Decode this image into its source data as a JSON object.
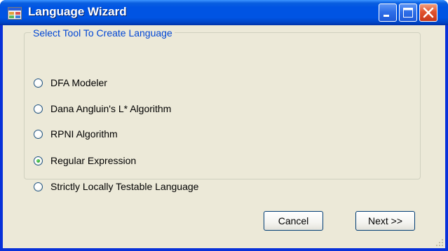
{
  "window": {
    "title": "Language Wizard",
    "icons": {
      "app": "app-icon",
      "minimize": "minimize-icon",
      "maximize": "maximize-icon",
      "close": "close-icon"
    }
  },
  "group": {
    "legend": "Select Tool To Create Language",
    "options": [
      {
        "label": "DFA Modeler",
        "selected": false
      },
      {
        "label": "Dana Angluin's L* Algorithm",
        "selected": false
      },
      {
        "label": "RPNI Algorithm",
        "selected": false
      },
      {
        "label": "Regular Expression",
        "selected": true
      },
      {
        "label": "Strictly Locally Testable Language",
        "selected": false
      }
    ]
  },
  "buttons": {
    "cancel": "Cancel",
    "next": "Next >>"
  },
  "colors": {
    "titlebar": "#0054e3",
    "client": "#ece9d8",
    "legend_text": "#0046d5",
    "close_button": "#e2532e"
  }
}
